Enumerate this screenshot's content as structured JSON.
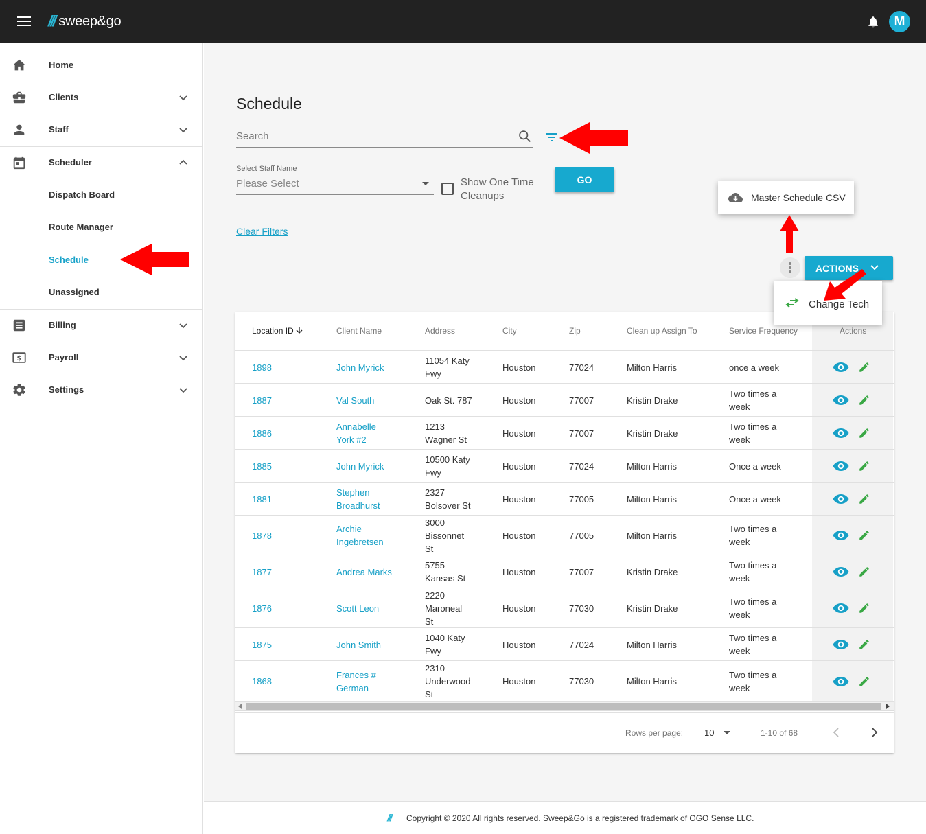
{
  "app": {
    "logo_text": "sweep&go",
    "logo_mark": "///",
    "avatar_letter": "M",
    "accent": "#17a9cf",
    "topbar_color": "#222222",
    "icons": {
      "menu": "hamburger-icon",
      "notifications": "bell-icon",
      "annotation": "red-arrow-icon"
    }
  },
  "sidebar": {
    "items": [
      {
        "label": "Home",
        "icon": "home-icon"
      },
      {
        "label": "Clients",
        "icon": "briefcase-icon"
      },
      {
        "label": "Staff",
        "icon": "person-icon"
      },
      {
        "label": "Scheduler",
        "icon": "calendar-icon"
      },
      {
        "label": "Dispatch Board"
      },
      {
        "label": "Route Manager"
      },
      {
        "label": "Schedule",
        "active": true
      },
      {
        "label": "Unassigned"
      },
      {
        "label": "Billing",
        "icon": "list-icon"
      },
      {
        "label": "Payroll",
        "icon": "dollar-icon"
      },
      {
        "label": "Settings",
        "icon": "gear-icon"
      }
    ]
  },
  "main": {
    "title": "Schedule",
    "search_placeholder": "Search",
    "staff_label": "Select Staff Name",
    "staff_value": "Please Select",
    "one_time_label": "Show One Time Cleanups",
    "go_label": "GO",
    "clear_filters": "Clear Filters",
    "csv_label": "Master Schedule CSV",
    "actions_label": "ACTIONS",
    "change_tech_label": "Change Tech"
  },
  "table": {
    "headers": [
      "Location ID",
      "Client Name",
      "Address",
      "City",
      "Zip",
      "Clean up Assign To",
      "Service Frequency",
      "Actions"
    ],
    "rows": [
      {
        "id": "1898",
        "name": [
          "John Myrick"
        ],
        "address": [
          "11054 Katy",
          "Fwy"
        ],
        "city": "Houston",
        "zip": "77024",
        "assign": "Milton Harris",
        "freq": [
          "once a week"
        ]
      },
      {
        "id": "1887",
        "name": [
          "Val South"
        ],
        "address": [
          "Oak St. 787"
        ],
        "city": "Houston",
        "zip": "77007",
        "assign": "Kristin Drake",
        "freq": [
          "Two times a",
          "week"
        ]
      },
      {
        "id": "1886",
        "name": [
          "Annabelle",
          "York #2"
        ],
        "address": [
          "1213",
          "Wagner St"
        ],
        "city": "Houston",
        "zip": "77007",
        "assign": "Kristin Drake",
        "freq": [
          "Two times a",
          "week"
        ]
      },
      {
        "id": "1885",
        "name": [
          "John Myrick"
        ],
        "address": [
          "10500 Katy",
          "Fwy"
        ],
        "city": "Houston",
        "zip": "77024",
        "assign": "Milton Harris",
        "freq": [
          "Once a week"
        ]
      },
      {
        "id": "1881",
        "name": [
          "Stephen",
          "Broadhurst"
        ],
        "address": [
          "2327",
          "Bolsover St"
        ],
        "city": "Houston",
        "zip": "77005",
        "assign": "Milton Harris",
        "freq": [
          "Once a week"
        ]
      },
      {
        "id": "1878",
        "name": [
          "Archie",
          "Ingebretsen"
        ],
        "address": [
          "3000",
          "Bissonnet",
          "St"
        ],
        "city": "Houston",
        "zip": "77005",
        "assign": "Milton Harris",
        "freq": [
          "Two times a",
          "week"
        ]
      },
      {
        "id": "1877",
        "name": [
          "Andrea Marks"
        ],
        "address": [
          "5755",
          "Kansas St"
        ],
        "city": "Houston",
        "zip": "77007",
        "assign": "Kristin Drake",
        "freq": [
          "Two times a",
          "week"
        ]
      },
      {
        "id": "1876",
        "name": [
          "Scott Leon"
        ],
        "address": [
          "2220",
          "Maroneal",
          "St"
        ],
        "city": "Houston",
        "zip": "77030",
        "assign": "Kristin Drake",
        "freq": [
          "Two times a",
          "week"
        ]
      },
      {
        "id": "1875",
        "name": [
          "John Smith"
        ],
        "address": [
          "1040 Katy",
          "Fwy"
        ],
        "city": "Houston",
        "zip": "77024",
        "assign": "Milton Harris",
        "freq": [
          "Two times a",
          "week"
        ]
      },
      {
        "id": "1868",
        "name": [
          "Frances #",
          "German"
        ],
        "address": [
          "2310",
          "Underwood",
          "St"
        ],
        "city": "Houston",
        "zip": "77030",
        "assign": "Milton Harris",
        "freq": [
          "Two times a",
          "week"
        ]
      }
    ],
    "row_icons": {
      "view": "eye-icon",
      "edit": "pencil-icon"
    },
    "view_color": "#17a0c7",
    "edit_color": "#3aa845"
  },
  "pagination": {
    "rows_per_page_label": "Rows per page:",
    "rows_per_page": "10",
    "range": "1-10 of 68"
  },
  "footer": {
    "text": "Copyright © 2020 All rights reserved. Sweep&Go is a registered trademark of OGO Sense LLC."
  }
}
